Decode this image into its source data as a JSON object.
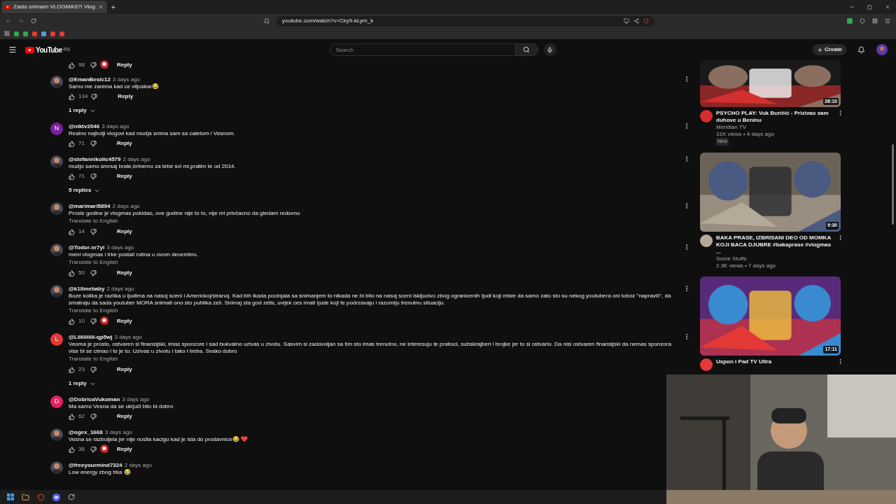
{
  "browser": {
    "tab": {
      "title": "Zasto snimam VLOGMAS?! Vlog",
      "selected": true
    },
    "new_tab": "+",
    "url": "youtube.com/watch?v=Cky9-kLym_k"
  },
  "header": {
    "logo": "YouTube",
    "region": "RS",
    "search_placeholder": "Search",
    "create": "Create"
  },
  "partial_comment": {
    "likes": "98",
    "hearted": true,
    "reply": "Reply"
  },
  "comments": [
    {
      "author": "@EmanBesic12",
      "time": "3 days ago",
      "text": "Samo me zanima kad ce viljuskar😂",
      "likes": "134",
      "hearted": false,
      "reply": "Reply",
      "replies": "1 reply"
    },
    {
      "author": "@niktv2046",
      "time": "3 days ago",
      "text": "Realno najbolji vlogovi kad mudja snima sam sa caletom i Vesnom.",
      "likes": "71",
      "hearted": false,
      "reply": "Reply",
      "avatar": {
        "kind": "letter",
        "letter": "N",
        "color": "#7b1fa2"
      }
    },
    {
      "author": "@stefannikolic4579",
      "time": "2 days ago",
      "text": "mudjo samo smrsaj brate,brinemo za tebe svi mi,pratim te od 2014.",
      "likes": "71",
      "hearted": false,
      "reply": "Reply",
      "replies": "5 replies"
    },
    {
      "author": "@marimari5894",
      "time": "2 days ago",
      "text": "Prosle godine je vlogmas pokidao, ove godine nije to to, nije mi privčacno da gledam redovno",
      "translate": "Translate to English",
      "likes": "14",
      "hearted": false,
      "reply": "Reply"
    },
    {
      "author": "@Todor-xr7yl",
      "time": "3 days ago",
      "text": "meni vlogmas i trke postali rutina u ovom decembru.",
      "translate": "Translate to English",
      "likes": "50",
      "hearted": false,
      "reply": "Reply"
    },
    {
      "author": "@k1llmebaby",
      "time": "2 days ago",
      "text": "Boze kolika je razlika u ljudima na nasoj sceni i Americkoj/stranoj. Kad bih ikada pocinjala sa snimanjem to nikada ne bi bilo na nasoj sceni iskljucivo zbog ogranicenih ljudi koji misle da samo zato sto su nekog youtubera oni toboz \"napravili\", da smatraju da sada youtuber MORA snimati ono sto publika zeli. Snimaj sta god zelis, uvijek ces imati ljude koji te podrzavaju i razumiju trenutnu situaciju.",
      "translate": "Translate to English",
      "likes": "10",
      "hearted": true,
      "reply": "Reply"
    },
    {
      "author": "@Liiiiiiiiiii-qp5wj",
      "time": "3 days ago",
      "text": "Veoma je prosto, ostvaren si finansijski, imas sponzore i sad bukvalno uzivas u zivotu. Sasvim si zadovoljan sa tim sto imas trenutno, ne interesuju te pratioci, subskrajberi i brojke jer to si ostvario. Da nisi ostvaren finansijski da nemas sponzora vise bi se cimao i to je to. Uzivas u zivotu i tako i treba. Svako dobro",
      "translate": "Translate to English",
      "likes": "23",
      "hearted": false,
      "reply": "Reply",
      "avatar": {
        "kind": "letter",
        "letter": "L",
        "color": "#e53935"
      },
      "replies": "1 reply"
    },
    {
      "author": "@DobricaVukoman",
      "time": "3 days ago",
      "text": "Ma samo Vesna da se uključi bilo bi dobro",
      "likes": "62",
      "hearted": false,
      "reply": "Reply",
      "avatar": {
        "kind": "letter",
        "letter": "D",
        "color": "#e91e63"
      }
    },
    {
      "author": "@ogex_1668",
      "time": "3 days ago",
      "text": "Vesna se razboljela jer nije nosila kacigu kad je isla do prodavnice😂 ❤️",
      "likes": "36",
      "hearted": true,
      "reply": "Reply"
    },
    {
      "author": "@freeyourmind7324",
      "time": "2 days ago",
      "text": "Low energy zbog trka 😂"
    }
  ],
  "videos": [
    {
      "duration": "38:10",
      "title": "PSYCHO PLAY: Vuk Đuričić - Prizivao sam duhove u Beninu",
      "channel": "Meridian TV",
      "meta": "31K views • 4 days ago",
      "badge": "New"
    },
    {
      "duration": "9:30",
      "title": "BAKA PRASE, IZBRISANI DEO OD MOMKA KOJI BACA DJUBRE #bakaprase #vlogmas ...",
      "channel": "Some Stuffs",
      "meta": "2.3K views • 7 days ago"
    },
    {
      "duration": "17:11",
      "title": "Uspon i Pad TV Ultra"
    }
  ]
}
